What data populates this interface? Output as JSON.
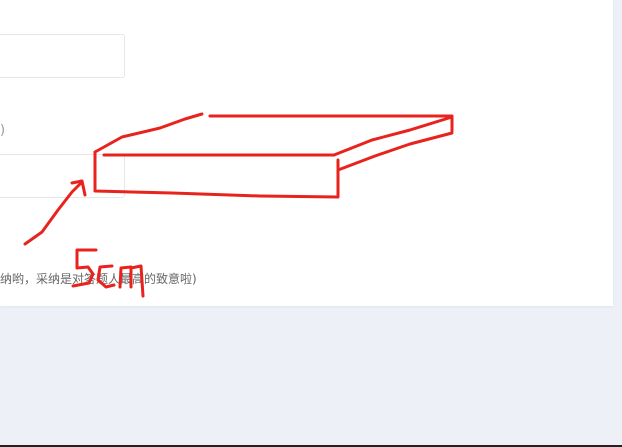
{
  "form": {
    "paren_label": ")",
    "hint_text": "纳哟，采纳是对答题人最高的致意啦)"
  },
  "annotation": {
    "label": "5cm",
    "stroke_color": "#e8231e"
  },
  "colors": {
    "page_background": "#edf1f7",
    "card_background": "#ffffff",
    "input_border": "#e7e7e7",
    "annotation_red": "#e8231e"
  }
}
